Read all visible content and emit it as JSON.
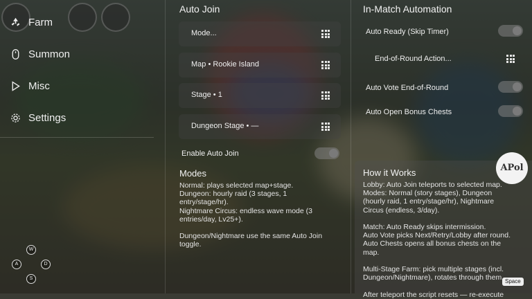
{
  "nav": {
    "items": [
      {
        "label": "Farm",
        "icon": "recycle-icon"
      },
      {
        "label": "Summon",
        "icon": "mouse-icon"
      },
      {
        "label": "Misc",
        "icon": "play-icon"
      },
      {
        "label": "Settings",
        "icon": "gear-icon"
      }
    ]
  },
  "dpad": {
    "up": "W",
    "left": "A",
    "right": "D",
    "down": "S"
  },
  "auto_join": {
    "title": "Auto Join",
    "rows": [
      {
        "label": "Mode..."
      },
      {
        "label": "Map • Rookie Island"
      },
      {
        "label": "Stage • 1"
      },
      {
        "label": "Dungeon Stage • —"
      }
    ],
    "enable_label": "Enable Auto Join",
    "enable_on": false
  },
  "modes": {
    "title": "Modes",
    "text": "Normal: plays selected map+stage.\nDungeon: hourly raid (3 stages, 1\nentry/stage/hr).\nNightmare Circus: endless wave mode (3\nentries/day, Lv25+).\n\nDungeon/Nightmare use the same Auto Join\ntoggle."
  },
  "automation": {
    "title": "In-Match Automation",
    "auto_ready": {
      "label": "Auto Ready (Skip Timer)",
      "on": false
    },
    "end_round_action": {
      "label": "End-of-Round Action..."
    },
    "auto_vote": {
      "label": "Auto Vote End-of-Round",
      "on": false
    },
    "auto_chests": {
      "label": "Auto Open Bonus Chests",
      "on": false
    }
  },
  "how": {
    "title": "How it Works",
    "text": "Lobby: Auto Join teleports to selected map.\nModes: Normal (story stages), Dungeon\n(hourly raid, 1 entry/stage/hr), Nightmare\nCircus (endless, 3/day).\n\nMatch: Auto Ready skips intermission.\nAuto Vote picks Next/Retry/Lobby after round.\nAuto Chests opens all bonus chests on the\nmap.\n\nMulti-Stage Farm: pick multiple stages (incl.\nDungeon/Nightmare), rotates through them.\n\nAfter teleport the script resets — re-execute"
  },
  "badge": {
    "text": "APol"
  },
  "space_key": "Space"
}
